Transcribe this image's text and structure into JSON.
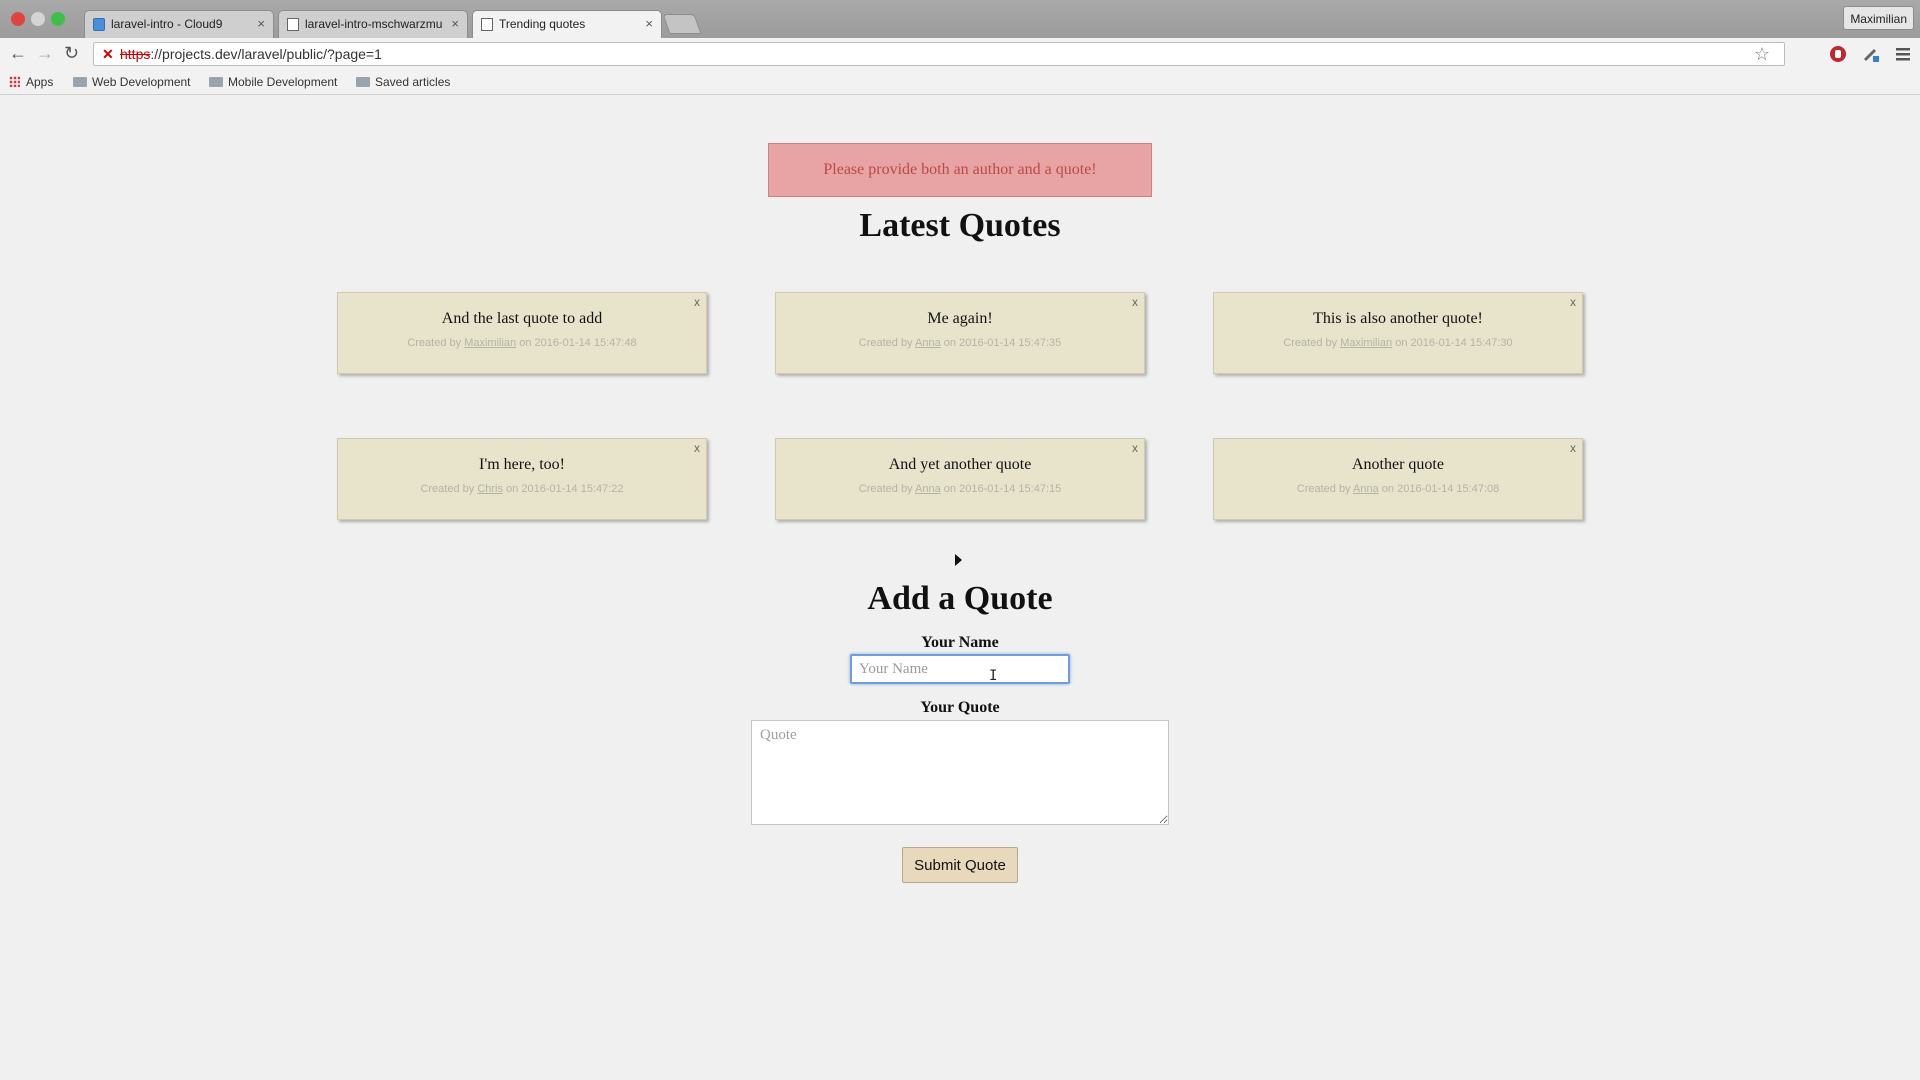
{
  "browser": {
    "tabs": [
      {
        "title": "laravel-intro - Cloud9",
        "icon": "cloud9-icon",
        "active": false
      },
      {
        "title": "laravel-intro-mschwarzmu",
        "icon": "page-icon",
        "active": false
      },
      {
        "title": "Trending quotes",
        "icon": "page-icon",
        "active": true
      }
    ],
    "profile_name": "Maximilian",
    "url_scheme": "https",
    "url_rest": "://projects.dev/laravel/public/?page=1",
    "bookmarks": [
      "Apps",
      "Web Development",
      "Mobile Development",
      "Saved articles"
    ]
  },
  "page": {
    "alert_message": "Please provide both an author and a quote!",
    "latest_heading": "Latest Quotes",
    "quotes": [
      {
        "text": "And the last quote to add",
        "created_prefix": "Created by",
        "author": "Maximilian",
        "on_prefix": "on",
        "timestamp": "2016-01-14 15:47:48",
        "delete": "x"
      },
      {
        "text": "Me again!",
        "created_prefix": "Created by",
        "author": "Anna",
        "on_prefix": "on",
        "timestamp": "2016-01-14 15:47:35",
        "delete": "x"
      },
      {
        "text": "This is also another quote!",
        "created_prefix": "Created by",
        "author": "Maximilian",
        "on_prefix": "on",
        "timestamp": "2016-01-14 15:47:30",
        "delete": "x"
      },
      {
        "text": "I'm here, too!",
        "created_prefix": "Created by",
        "author": "Chris",
        "on_prefix": "on",
        "timestamp": "2016-01-14 15:47:22",
        "delete": "x"
      },
      {
        "text": "And yet another quote",
        "created_prefix": "Created by",
        "author": "Anna",
        "on_prefix": "on",
        "timestamp": "2016-01-14 15:47:15",
        "delete": "x"
      },
      {
        "text": "Another quote",
        "created_prefix": "Created by",
        "author": "Anna",
        "on_prefix": "on",
        "timestamp": "2016-01-14 15:47:08",
        "delete": "x"
      }
    ],
    "form": {
      "heading": "Add a Quote",
      "name_label": "Your Name",
      "name_placeholder": "Your Name",
      "name_value": "",
      "quote_label": "Your Quote",
      "quote_placeholder": "Quote",
      "quote_value": "",
      "submit_label": "Submit Quote"
    }
  },
  "colors": {
    "alert_bg": "#e8a4a4",
    "alert_text": "#b94a48",
    "card_bg": "#e8e4cc",
    "button_bg": "#e8d9bd",
    "page_bg": "#f0f0f0"
  }
}
